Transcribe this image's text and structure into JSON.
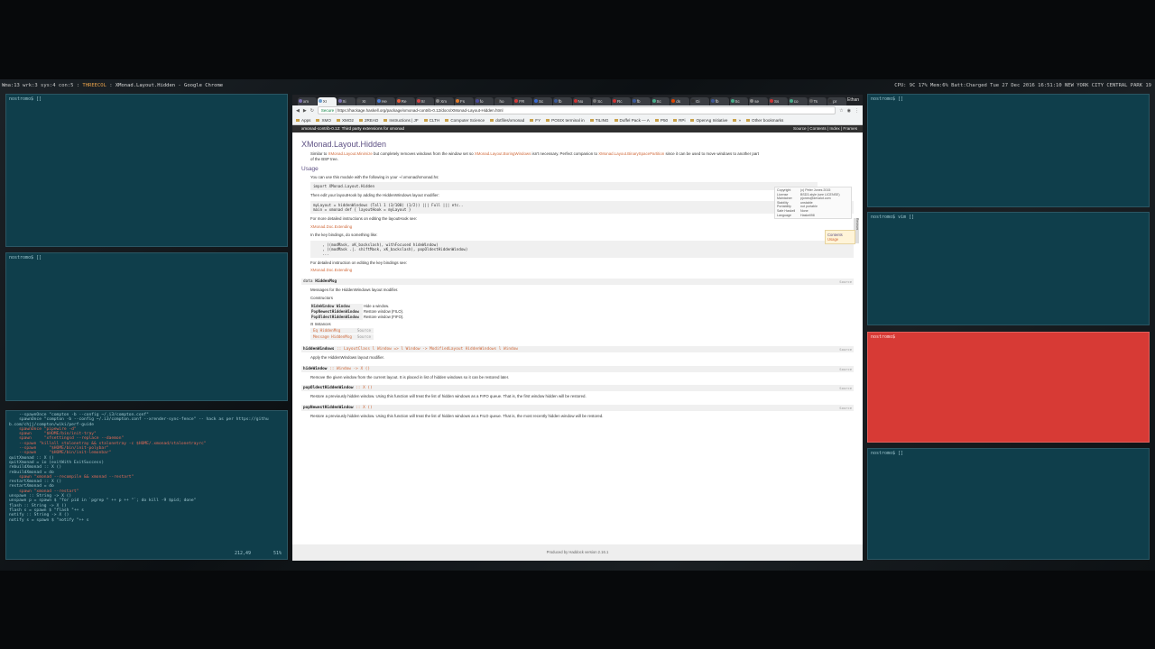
{
  "statusbar": {
    "left": "Wma:13  wrk:3  sys:4  con:5",
    "layout": "THREECOL",
    "title": "XMonad.Layout.Hidden - Google Chrome",
    "right": "CPU: 9C 17%  Mem:6%  Batt:Charged  Tue 27 Dec 2016 16:51:10  NEW YORK CITY CENTRAL PARK  19"
  },
  "terminals": {
    "prompt": "nostromo$ []",
    "prompt_vim": "nostromo$ vim []",
    "prompt_red": "nostromo$",
    "position": "212,49",
    "position_pct": "51%"
  },
  "editor_lines": [
    {
      "t": "    --spawnOnce \"compton -b --config ~/.i3/compton.conf\"",
      "c": ""
    },
    {
      "t": "    spawnOnce \"compton -b --config ~/.i3/compton.conf --xrender-sync-fence\" -- hack as per https://githu",
      "c": ""
    },
    {
      "t": "b.com/chjj/compton/wiki/perf-guide",
      "c": ""
    },
    {
      "t": "    spawnOnce \"pipewire -d\"",
      "c": "c-red"
    },
    {
      "t": "    spawn     \"$HOME/bin/init-tray\"",
      "c": "c-red"
    },
    {
      "t": "    spawn     \"xfsettingsd --replace --daemon\"",
      "c": "c-red"
    },
    {
      "t": "    --spawn \"killall stalonetray && stalonetray -c $HOME/.xmonad/stalonetrayrc\"",
      "c": "c-red"
    },
    {
      "t": "    --spawn     \"$HOME/bin/init-polybar\"",
      "c": "c-red"
    },
    {
      "t": "    --spawn     \"$HOME/bin/init-lemonbar\"",
      "c": "c-red"
    },
    {
      "t": "",
      "c": ""
    },
    {
      "t": "quitXmonad :: X ()",
      "c": ""
    },
    {
      "t": "quitXmonad = io (exitWith ExitSuccess)",
      "c": ""
    },
    {
      "t": "",
      "c": ""
    },
    {
      "t": "rebuildXmonad :: X ()",
      "c": ""
    },
    {
      "t": "rebuildXmonad = do",
      "c": ""
    },
    {
      "t": "    spawn \"xmonad --recompile && xmonad --restart\"",
      "c": "c-red"
    },
    {
      "t": "",
      "c": ""
    },
    {
      "t": "restartXmonad :: X ()",
      "c": ""
    },
    {
      "t": "restartXmonad = do",
      "c": ""
    },
    {
      "t": "    spawn \"xmonad --restart\"",
      "c": "c-red"
    },
    {
      "t": "",
      "c": ""
    },
    {
      "t": "unspawn :: String -> X ()",
      "c": ""
    },
    {
      "t": "unspawn p = spawn $ \"for pid in `pgrep \" ++ p ++ \"`; do kill -9 $pid; done\"",
      "c": ""
    },
    {
      "t": "",
      "c": ""
    },
    {
      "t": "flash :: String -> X ()",
      "c": ""
    },
    {
      "t": "flash s = spawn $ \"flash \"++ s",
      "c": ""
    },
    {
      "t": "",
      "c": ""
    },
    {
      "t": "notify :: String -> X ()",
      "c": ""
    },
    {
      "t": "notify s = spawn $ \"notify \"++ s",
      "c": ""
    }
  ],
  "browser": {
    "tabs": [
      "xm",
      "XI",
      "Xi",
      "XI",
      "He",
      "Re",
      "Xr",
      "Xm",
      "Fs",
      "fo",
      "ho",
      "FR",
      "Sc",
      "fb",
      "No",
      "Sc",
      "Rc",
      "fb",
      "Sc",
      "ds",
      "Gi",
      "fb",
      "Sc",
      "se",
      "Ss",
      "co",
      "Ts",
      "pr"
    ],
    "user": "Ethan",
    "url_secure": "Secure",
    "url": "https://hackage.haskell.org/package/xmonad-contrib-0.12/docs/XMonad-Layout-Hidden.html",
    "bookmarks": [
      "Apps",
      "XMO",
      "XMO2",
      "2READ",
      "Instructions | JF",
      "CLTH",
      "Computer Science",
      "dotfiles/xmonad",
      "FY",
      "POSIX terminal in",
      "TILING",
      "Duffel Pack — A",
      "P50",
      "RPi",
      "OpenAg Initiative",
      "»",
      "Other bookmarks"
    ]
  },
  "doc": {
    "package": "xmonad-contrib-0.12: Third party extensions for xmonad",
    "toplinks": "Source | Contents | Index | Frames",
    "title": "XMonad.Layout.Hidden",
    "info": [
      [
        "Copyright",
        "(c) Peter Jones 2015"
      ],
      [
        "License",
        "BSD3-style (see LICENSE)"
      ],
      [
        "Maintainer",
        "pjones@devalot.com"
      ],
      [
        "Stability",
        "unstable"
      ],
      [
        "Portability",
        "not portable"
      ],
      [
        "Safe Haskell",
        "None"
      ],
      [
        "Language",
        "Haskell98"
      ]
    ],
    "contents_title": "Contents",
    "contents_item": "Usage",
    "reviews": "Reviews",
    "intro_a": "Similar to ",
    "intro_link1": "XMonad.Layout.Minimize",
    "intro_b": " but completely removes windows from the window set so ",
    "intro_link2": "XMonad.Layout.BoringWindows",
    "intro_c": " isn't necessary. Perfect companion to ",
    "intro_link3": "XMonad.Layout.BinarySpacePartition",
    "intro_d": " since it can be used to move windows to another part of the BSP tree.",
    "usage_heading": "Usage",
    "usage_p1": "You can use this module with the following in your ~/.xmonad/xmonad.hs:",
    "usage_code1": "import XMonad.Layout.Hidden",
    "usage_p2": "Then edit your layoutHook by adding the HiddenWindows layout modifier:",
    "usage_code2": "myLayout = hiddenWindows (Tall 1 (3/100) (1/2)) ||| Full ||| etc..\nmain = xmonad def { layoutHook = myLayout }",
    "usage_p3": "For more detailed instructions on editing the layoutHook see:",
    "usage_link3": "XMonad.Doc.Extending",
    "usage_p4": "In the key bindings, do something like:",
    "usage_code3": "    , ((modMask, xK_backslash), withFocused hideWindow)\n    , ((modMask .|. shiftMask, xK_backslash), popOldestHiddenWindow)\n    ...",
    "usage_p5": "For detailed instruction on editing the key bindings see:",
    "usage_link5": "XMonad.Doc.Extending",
    "data_kw": "data",
    "data_name": "HiddenMsg",
    "source": "Source",
    "data_desc": "Messages for the HiddenWindows layout modifier.",
    "constructors_label": "Constructors",
    "constructors": [
      {
        "name": "HideWindow Window",
        "desc": "Hide a window."
      },
      {
        "name": "PopNewestHiddenWindow",
        "desc": "Restore window (FILO)."
      },
      {
        "name": "PopOldestHiddenWindow",
        "desc": "Restore window (FIFO)."
      }
    ],
    "instances_label": "Instances",
    "instances": [
      "Eq HiddenMsg",
      "Message HiddenMsg"
    ],
    "fn1_name": "hiddenWindows",
    "fn1_sig": " :: LayoutClass l Window => l Window -> ModifiedLayout HiddenWindows l Window",
    "fn1_desc": "Apply the HiddenWindows layout modifier.",
    "fn2_name": "hideWindow",
    "fn2_sig": " :: Window -> X ()",
    "fn2_desc": "Remove the given window from the current layout. It is placed in list of hidden windows so it can be restored later.",
    "fn3_name": "popOldestHiddenWindow",
    "fn3_sig": " :: X ()",
    "fn3_desc": "Restore a previously hidden window. Using this function will treat the list of hidden windows as a FIFO queue. That is, the first window hidden will be restored.",
    "fn4_name": "popNewestHiddenWindow",
    "fn4_sig": " :: X ()",
    "fn4_desc": "Restore a previously hidden window. Using this function will treat the list of hidden windows as a FILO queue. That is, the most recently hidden window will be restored.",
    "footer": "Produced by Haddock version 2.16.1"
  }
}
